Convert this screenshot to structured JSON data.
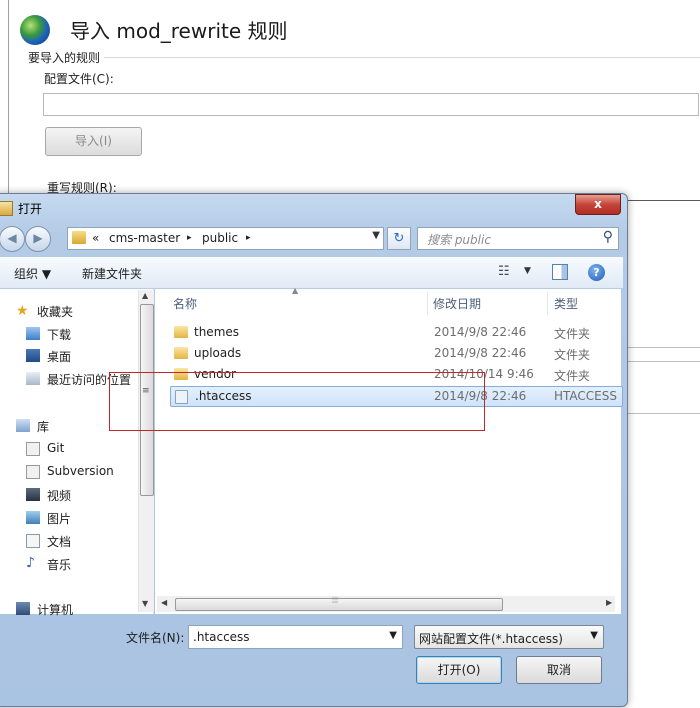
{
  "background_page": {
    "title": "导入 mod_rewrite 规则",
    "section_label": "要导入的规则",
    "config_label": "配置文件(C):",
    "config_value": "",
    "import_button": "导入(I)",
    "rules_label": "重写规则(R):"
  },
  "dialog": {
    "title": "打开",
    "close_glyph": "x",
    "address": {
      "overflow": "«",
      "segments": [
        "cms-master",
        "public"
      ],
      "separator": "▸"
    },
    "search_placeholder": "搜索 public",
    "toolbar": {
      "organize": "组织 ▼",
      "new_folder": "新建文件夹"
    },
    "nav": {
      "favorites": "收藏夹",
      "downloads": "下载",
      "desktop": "桌面",
      "recent": "最近访问的位置",
      "libraries": "库",
      "git": "Git",
      "subversion": "Subversion",
      "videos": "视频",
      "pictures": "图片",
      "documents": "文档",
      "music": "音乐",
      "computer": "计算机"
    },
    "columns": {
      "name": "名称",
      "modified": "修改日期",
      "type": "类型"
    },
    "files": [
      {
        "name": "themes",
        "modified": "2014/9/8 22:46",
        "type": "文件夹",
        "kind": "folder-icon"
      },
      {
        "name": "uploads",
        "modified": "2014/9/8 22:46",
        "type": "文件夹",
        "kind": "folder-icon"
      },
      {
        "name": "vendor",
        "modified": "2014/10/14 9:46",
        "type": "文件夹",
        "kind": "folder-icon"
      },
      {
        "name": ".htaccess",
        "modified": "2014/9/8 22:46",
        "type": "HTACCESS",
        "kind": "file-icon",
        "selected": true
      }
    ],
    "filename_label": "文件名(N):",
    "filename_value": ".htaccess",
    "filetype_value": "网站配置文件(*.htaccess)",
    "open_button": "打开(O)",
    "cancel_button": "取消"
  },
  "colors": {
    "highlight_box": "#c0262c",
    "selection": "#cfe3fa",
    "dialog_frame": "#b4cbe6"
  }
}
